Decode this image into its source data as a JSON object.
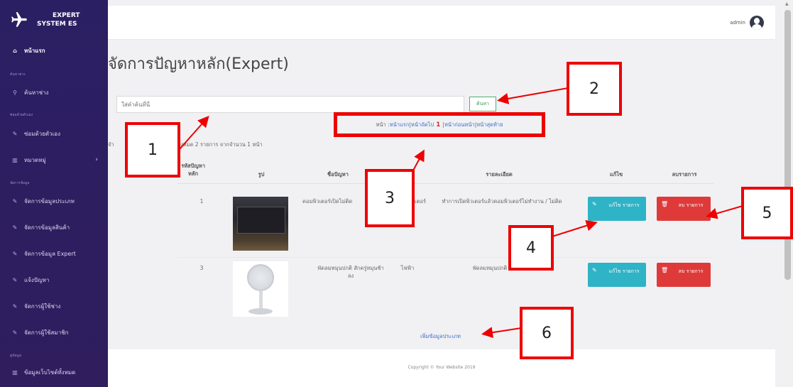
{
  "sidebar": {
    "logo_line1": "EXPERT",
    "logo_line2": "SYSTEM ES",
    "items": [
      {
        "label": "หน้าแรก",
        "icon": "home-icon"
      },
      {
        "label": "ค้นหาช่าง",
        "icon": "search-icon"
      },
      {
        "label": "ซ่อมด้วยตัวเอง",
        "icon": "wrench-icon"
      },
      {
        "label": "หมวดหมู่",
        "icon": "bars-icon"
      },
      {
        "label": "จัดการข้อมูลประเภท",
        "icon": "wrench-icon"
      },
      {
        "label": "จัดการข้อมูลสินค้า",
        "icon": "wrench-icon"
      },
      {
        "label": "จัดการข้อมูล Expert",
        "icon": "wrench-icon"
      },
      {
        "label": "แจ้งปัญหา",
        "icon": "wrench-icon"
      },
      {
        "label": "จัดการผู้ใช้ช่าง",
        "icon": "wrench-icon"
      },
      {
        "label": "จัดการผู้ใช้สมาชิก",
        "icon": "wrench-icon"
      },
      {
        "label": "ข้อมูลเว็บไซต์ทั้งหมด",
        "icon": "bars-icon"
      }
    ],
    "headers": [
      "ค้นหาช่าง",
      "ซ่อมด้วยตัวเอง",
      "จัดการข้อมูล",
      "ดูข้อมูล"
    ]
  },
  "topbar": {
    "user": "admin"
  },
  "page": {
    "title": "จัดการปัญหาหลัก(Expert)"
  },
  "search": {
    "placeholder": "ใส่คำค้นที่นี่",
    "button": "ค้นหา"
  },
  "pager": {
    "prefix": "หน้า : ",
    "first": "หน้าแรก",
    "next": "หน้าถัดไป",
    "current": "1",
    "prev": "หน้าก่อนหน้า",
    "last": "หน้าสุดท้าย",
    "sep": " | "
  },
  "count_text_a": "จำ",
  "count_text_b": "ทั้งหมด 2 รายการ จากจำนวน 1 หน้า",
  "table": {
    "headers": [
      "รหัสปัญหา หลัก",
      "รูป",
      "ชื่อปัญหา",
      "ประเภท",
      "รายละเอียด",
      "แก้ไข",
      "ลบรายการ"
    ],
    "rows": [
      {
        "id": "1",
        "image": "monitor",
        "name": "คอมพิวเตอร์เปิดไม่ติด",
        "type": "คอมพิวเตอร์",
        "detail": "ทำการเปิดพิวเตอร์แล้วคอมพิวเตอร์ไม่ทำงาน / ไม่ติด"
      },
      {
        "id": "3",
        "image": "fan",
        "name": "พัดลมหมุนปกติ สักครู่หมุนช้าลง",
        "type": "ไฟฟ้า",
        "detail": "พัดลมหมุนปกติ"
      }
    ],
    "edit_label": "แก้ไข รายการ",
    "delete_label": "ลบ รายการ"
  },
  "add_link": "เพิ่มข้อมูลประเภท",
  "footer": "Copyright © Your Website 2019",
  "callouts": [
    "1",
    "2",
    "3",
    "4",
    "5",
    "6"
  ],
  "colors": {
    "sidebar": "#2b1f63",
    "callout": "#ee0000",
    "edit": "#2fb3c6",
    "delete": "#df3a3a",
    "search_btn": "#4cb36e"
  }
}
